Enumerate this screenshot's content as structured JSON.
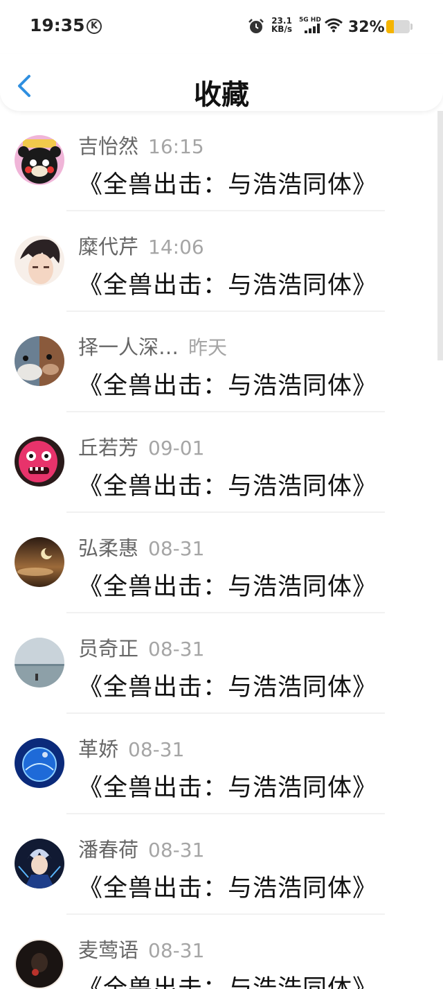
{
  "status": {
    "time": "19:35",
    "k_badge": "K",
    "net_speed_value": "23.1",
    "net_speed_unit": "KB/s",
    "network_type": "5G HD",
    "battery_percent": "32%",
    "battery_level": 0.32,
    "battery_color": "#f5b400"
  },
  "header": {
    "title": "收藏",
    "back_icon": "chevron-left-icon",
    "accent": "#2f8fe0"
  },
  "items": [
    {
      "name": "吉怡然",
      "time": "16:15",
      "content": "《全兽出击：与浩浩同体》",
      "avatar": "bear-mascot"
    },
    {
      "name": "糜代芹",
      "time": "14:06",
      "content": "《全兽出击：与浩浩同体》",
      "avatar": "anime-boy"
    },
    {
      "name": "择一人深…",
      "time": "昨天",
      "content": "《全兽出击：与浩浩同体》",
      "avatar": "cartoon-animals"
    },
    {
      "name": "丘若芳",
      "time": "09-01",
      "content": "《全兽出击：与浩浩同体》",
      "avatar": "pink-monster"
    },
    {
      "name": "弘柔惠",
      "time": "08-31",
      "content": "《全兽出击：与浩浩同体》",
      "avatar": "moon-night"
    },
    {
      "name": "员奇正",
      "time": "08-31",
      "content": "《全兽出击：与浩浩同体》",
      "avatar": "sea-horizon"
    },
    {
      "name": "革娇",
      "time": "08-31",
      "content": "《全兽出击：与浩浩同体》",
      "avatar": "blue-globe"
    },
    {
      "name": "潘春荷",
      "time": "08-31",
      "content": "《全兽出击：与浩浩同体》",
      "avatar": "anime-hero"
    },
    {
      "name": "麦莺语",
      "time": "08-31",
      "content": "《全兽出击：与浩浩同体》",
      "avatar": "dark-portrait"
    }
  ]
}
